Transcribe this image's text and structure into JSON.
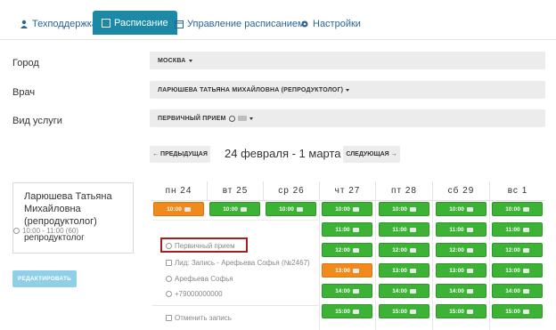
{
  "tabs": [
    {
      "label": "Техподдержка",
      "icon": "person-icon",
      "active": false
    },
    {
      "label": "Расписание",
      "icon": "calendar-check-icon",
      "active": true
    },
    {
      "label": "Управление расписанием",
      "icon": "calendar-icon",
      "active": false
    },
    {
      "label": "Настройки",
      "icon": "gear-icon",
      "active": false
    }
  ],
  "form": {
    "city_label": "Город",
    "city_value": "МОСКВА",
    "doctor_label": "Врач",
    "doctor_value": "ЛАРЮШЕВА ТАТЬЯНА МИХАЙЛОВНА (РЕПРОДУКТОЛОГ)",
    "service_label": "Вид услуги",
    "service_value": "ПЕРВИЧНЫЙ ПРИЕМ"
  },
  "week_nav": {
    "prev_label": "← ПРЕДЫДУЩАЯ",
    "title": "24 февраля - 1 марта",
    "next_label": "СЛЕДУЮЩАЯ →"
  },
  "doctor_card": {
    "name": "Ларюшева Татьяна Михайловна (репродуктолог)",
    "specialty": "репродуктолог",
    "edit_label": "РЕДАКТИРОВАТЬ"
  },
  "days": [
    {
      "label": "пн 24"
    },
    {
      "label": "вт 25"
    },
    {
      "label": "ср 26"
    },
    {
      "label": "чт 27"
    },
    {
      "label": "пт 28"
    },
    {
      "label": "сб 29"
    },
    {
      "label": "вс 1"
    }
  ],
  "slots": {
    "mon": [
      {
        "time": "10:00",
        "status": "booked"
      }
    ],
    "tue": [
      {
        "time": "10:00",
        "status": "free"
      }
    ],
    "wed": [
      {
        "time": "10:00",
        "status": "free"
      }
    ],
    "thu": [
      {
        "time": "10:00",
        "status": "free"
      },
      {
        "time": "11:00",
        "status": "free"
      },
      {
        "time": "12:00",
        "status": "free"
      },
      {
        "time": "13:00",
        "status": "booked"
      },
      {
        "time": "14:00",
        "status": "free"
      },
      {
        "time": "15:00",
        "status": "free"
      }
    ],
    "fri": [
      {
        "time": "10:00",
        "status": "free"
      },
      {
        "time": "11:00",
        "status": "free"
      },
      {
        "time": "12:00",
        "status": "free"
      },
      {
        "time": "13:00",
        "status": "free"
      },
      {
        "time": "14:00",
        "status": "free"
      },
      {
        "time": "15:00",
        "status": "free"
      }
    ],
    "sat": [
      {
        "time": "10:00",
        "status": "free"
      },
      {
        "time": "11:00",
        "status": "free"
      },
      {
        "time": "12:00",
        "status": "free"
      },
      {
        "time": "13:00",
        "status": "free"
      },
      {
        "time": "14:00",
        "status": "free"
      },
      {
        "time": "15:00",
        "status": "free"
      }
    ],
    "sun": [
      {
        "time": "10:00",
        "status": "free"
      },
      {
        "time": "11:00",
        "status": "free"
      },
      {
        "time": "12:00",
        "status": "free"
      },
      {
        "time": "13:00",
        "status": "free"
      },
      {
        "time": "14:00",
        "status": "free"
      },
      {
        "time": "15:00",
        "status": "free"
      }
    ]
  },
  "popover": {
    "time": "10:00 - 11:00 (60)",
    "service": "Первичный прием",
    "lead": "Лид: Запись - Арефьева Софья (№2467)",
    "patient": "Арефьева Софья",
    "phone": "+79000000000",
    "cancel_label": "Отменить запись"
  },
  "colors": {
    "accent": "#1c8aa6",
    "free_slot": "#3cb335",
    "booked_slot": "#f08a1c",
    "highlight": "#a5201c"
  }
}
